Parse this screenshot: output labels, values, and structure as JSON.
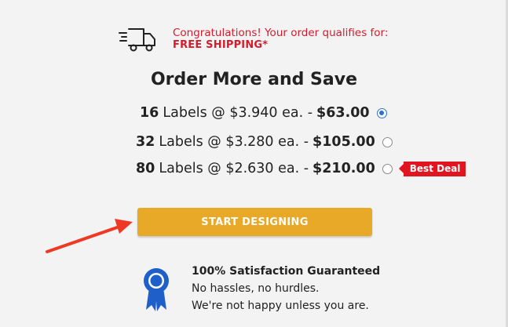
{
  "shipping": {
    "icon": "truck-icon",
    "message": "Congratulations! Your order qualifies for:",
    "highlight": "FREE SHIPPING*"
  },
  "title": "Order More and Save",
  "options": [
    {
      "quantity": "16",
      "unit_text": "Labels @ $3.940 ea. -",
      "total": "$63.00",
      "selected": true
    },
    {
      "quantity": "32",
      "unit_text": "Labels @ $3.280 ea. -",
      "total": "$105.00",
      "selected": false
    },
    {
      "quantity": "80",
      "unit_text": "Labels @ $2.630 ea. -",
      "total": "$210.00",
      "selected": false,
      "badge": "Best Deal"
    }
  ],
  "cta": {
    "label": "START DESIGNING"
  },
  "guarantee": {
    "icon": "ribbon-award-icon",
    "title": "100% Satisfaction Guaranteed",
    "line1": "No hassles, no hurdles.",
    "line2": "We're not happy unless you are."
  },
  "annotation": {
    "icon": "red-arrow-icon"
  },
  "colors": {
    "accent_red": "#e0151f",
    "button_gold": "#e8a928",
    "radio_blue": "#2f6fd6",
    "background": "#f3f3f3"
  }
}
